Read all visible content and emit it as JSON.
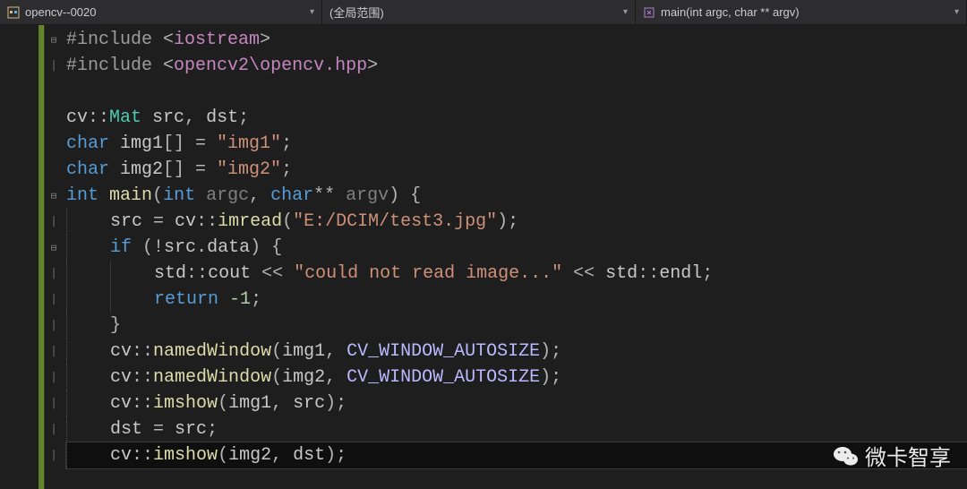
{
  "navbar": {
    "project": "opencv--0020",
    "scope": "(全局范围)",
    "function": "main(int argc, char ** argv)"
  },
  "code": {
    "lines": [
      {
        "fold": "⊟",
        "frag": [
          [
            "pp",
            "#include "
          ],
          [
            "op",
            "<"
          ],
          [
            "inc",
            "iostream"
          ],
          [
            "op",
            ">"
          ]
        ]
      },
      {
        "fold": "│",
        "frag": [
          [
            "pp",
            "#include "
          ],
          [
            "op",
            "<"
          ],
          [
            "inc",
            "opencv2\\opencv.hpp"
          ],
          [
            "op",
            ">"
          ]
        ]
      },
      {
        "fold": "",
        "frag": []
      },
      {
        "fold": "",
        "frag": [
          [
            "id",
            "cv"
          ],
          [
            "op",
            "::"
          ],
          [
            "ty",
            "Mat"
          ],
          [
            "id",
            " src"
          ],
          [
            "op",
            ", "
          ],
          [
            "id",
            "dst"
          ],
          [
            "op",
            ";"
          ]
        ]
      },
      {
        "fold": "",
        "frag": [
          [
            "kw",
            "char"
          ],
          [
            "id",
            " img1"
          ],
          [
            "op",
            "[] = "
          ],
          [
            "str",
            "\"img1\""
          ],
          [
            "op",
            ";"
          ]
        ]
      },
      {
        "fold": "",
        "frag": [
          [
            "kw",
            "char"
          ],
          [
            "id",
            " img2"
          ],
          [
            "op",
            "[] = "
          ],
          [
            "str",
            "\"img2\""
          ],
          [
            "op",
            ";"
          ]
        ]
      },
      {
        "fold": "⊟",
        "frag": [
          [
            "kw",
            "int"
          ],
          [
            "id",
            " "
          ],
          [
            "fn",
            "main"
          ],
          [
            "op",
            "("
          ],
          [
            "kw",
            "int"
          ],
          [
            "id",
            " "
          ],
          [
            "param",
            "argc"
          ],
          [
            "op",
            ", "
          ],
          [
            "kw",
            "char"
          ],
          [
            "op",
            "** "
          ],
          [
            "param",
            "argv"
          ],
          [
            "op",
            ") {"
          ]
        ]
      },
      {
        "fold": "│",
        "indent": 1,
        "frag": [
          [
            "id",
            "src "
          ],
          [
            "op",
            "= "
          ],
          [
            "id",
            "cv"
          ],
          [
            "op",
            "::"
          ],
          [
            "fn",
            "imread"
          ],
          [
            "op",
            "("
          ],
          [
            "str",
            "\"E:/DCIM/test3.jpg\""
          ],
          [
            "op",
            ");"
          ]
        ]
      },
      {
        "fold": "⊟",
        "indent": 1,
        "frag": [
          [
            "kw",
            "if"
          ],
          [
            "op",
            " (!"
          ],
          [
            "id",
            "src"
          ],
          [
            "op",
            "."
          ],
          [
            "id",
            "data"
          ],
          [
            "op",
            ") {"
          ]
        ]
      },
      {
        "fold": "│",
        "indent": 2,
        "frag": [
          [
            "id",
            "std"
          ],
          [
            "op",
            "::"
          ],
          [
            "id",
            "cout"
          ],
          [
            "op",
            " << "
          ],
          [
            "str",
            "\"could not read image...\""
          ],
          [
            "op",
            " << "
          ],
          [
            "id",
            "std"
          ],
          [
            "op",
            "::"
          ],
          [
            "id",
            "endl"
          ],
          [
            "op",
            ";"
          ]
        ]
      },
      {
        "fold": "│",
        "indent": 2,
        "frag": [
          [
            "kw",
            "return"
          ],
          [
            "num",
            " -1"
          ],
          [
            "op",
            ";"
          ]
        ]
      },
      {
        "fold": "│",
        "indent": 1,
        "frag": [
          [
            "op",
            "}"
          ]
        ]
      },
      {
        "fold": "│",
        "indent": 1,
        "frag": [
          [
            "id",
            "cv"
          ],
          [
            "op",
            "::"
          ],
          [
            "fn",
            "namedWindow"
          ],
          [
            "op",
            "("
          ],
          [
            "id",
            "img1"
          ],
          [
            "op",
            ", "
          ],
          [
            "macro",
            "CV_WINDOW_AUTOSIZE"
          ],
          [
            "op",
            ");"
          ]
        ]
      },
      {
        "fold": "│",
        "indent": 1,
        "frag": [
          [
            "id",
            "cv"
          ],
          [
            "op",
            "::"
          ],
          [
            "fn",
            "namedWindow"
          ],
          [
            "op",
            "("
          ],
          [
            "id",
            "img2"
          ],
          [
            "op",
            ", "
          ],
          [
            "macro",
            "CV_WINDOW_AUTOSIZE"
          ],
          [
            "op",
            ");"
          ]
        ]
      },
      {
        "fold": "│",
        "indent": 1,
        "frag": [
          [
            "id",
            "cv"
          ],
          [
            "op",
            "::"
          ],
          [
            "fn",
            "imshow"
          ],
          [
            "op",
            "("
          ],
          [
            "id",
            "img1"
          ],
          [
            "op",
            ", "
          ],
          [
            "id",
            "src"
          ],
          [
            "op",
            ");"
          ]
        ]
      },
      {
        "fold": "│",
        "indent": 1,
        "frag": [
          [
            "id",
            "dst "
          ],
          [
            "op",
            "= "
          ],
          [
            "id",
            "src"
          ],
          [
            "op",
            ";"
          ]
        ]
      },
      {
        "fold": "│",
        "indent": 1,
        "current": true,
        "frag": [
          [
            "id",
            "cv"
          ],
          [
            "op",
            "::"
          ],
          [
            "fn",
            "imshow"
          ],
          [
            "op",
            "("
          ],
          [
            "id",
            "img2"
          ],
          [
            "op",
            ", "
          ],
          [
            "id",
            "dst"
          ],
          [
            "op",
            ");"
          ]
        ]
      }
    ]
  },
  "watermark": {
    "text": "微卡智享"
  }
}
